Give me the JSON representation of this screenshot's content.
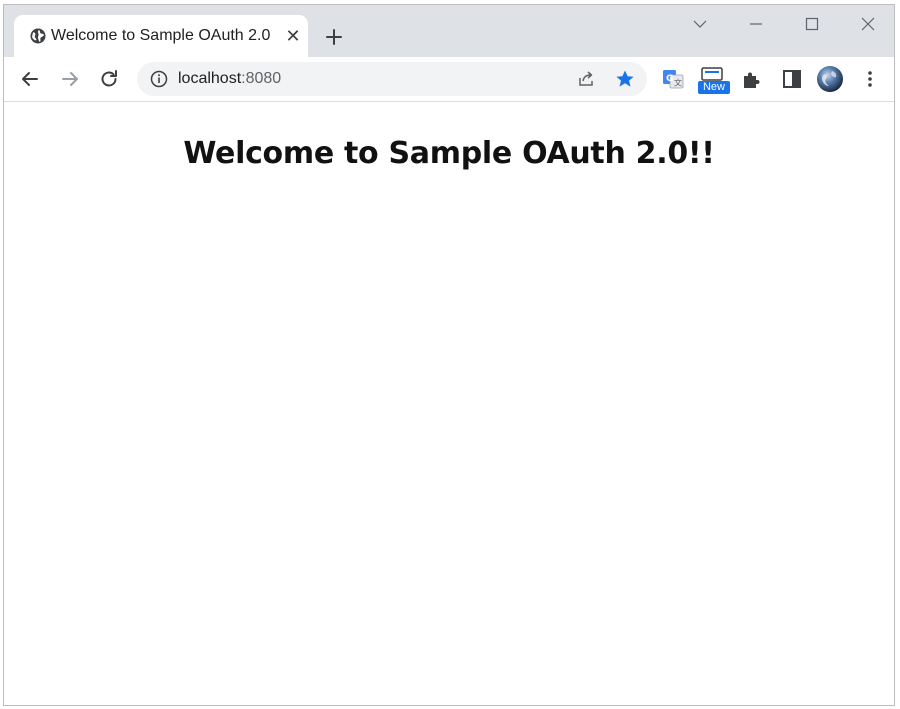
{
  "tab": {
    "title": "Welcome to Sample OAuth 2.0",
    "favicon": "globe-icon",
    "close_icon": "close-icon"
  },
  "new_tab_icon": "plus-icon",
  "window_controls": [
    "tab-search-icon",
    "minimize-icon",
    "maximize-icon",
    "close-icon"
  ],
  "toolbar": {
    "back_icon": "arrow-left-icon",
    "forward_icon": "arrow-right-icon",
    "reload_icon": "reload-icon"
  },
  "omnibox": {
    "info_icon": "info-icon",
    "host": "localhost",
    "port": ":8080",
    "share_icon": "share-icon",
    "bookmark_icon": "star-icon"
  },
  "extensions": {
    "translate_icon": "google-translate-icon",
    "new_extension_icon": "new-extension-icon",
    "new_badge": "New",
    "puzzle_icon": "puzzle-icon",
    "side_panel_icon": "side-panel-icon",
    "profile_icon": "profile-avatar-icon",
    "menu_icon": "kebab-menu-icon"
  },
  "page": {
    "heading": "Welcome to Sample OAuth 2.0!!"
  },
  "colors": {
    "tabstrip_bg": "#dee1e6",
    "omnibox_bg": "#f1f3f4",
    "accent": "#1a73e8"
  }
}
